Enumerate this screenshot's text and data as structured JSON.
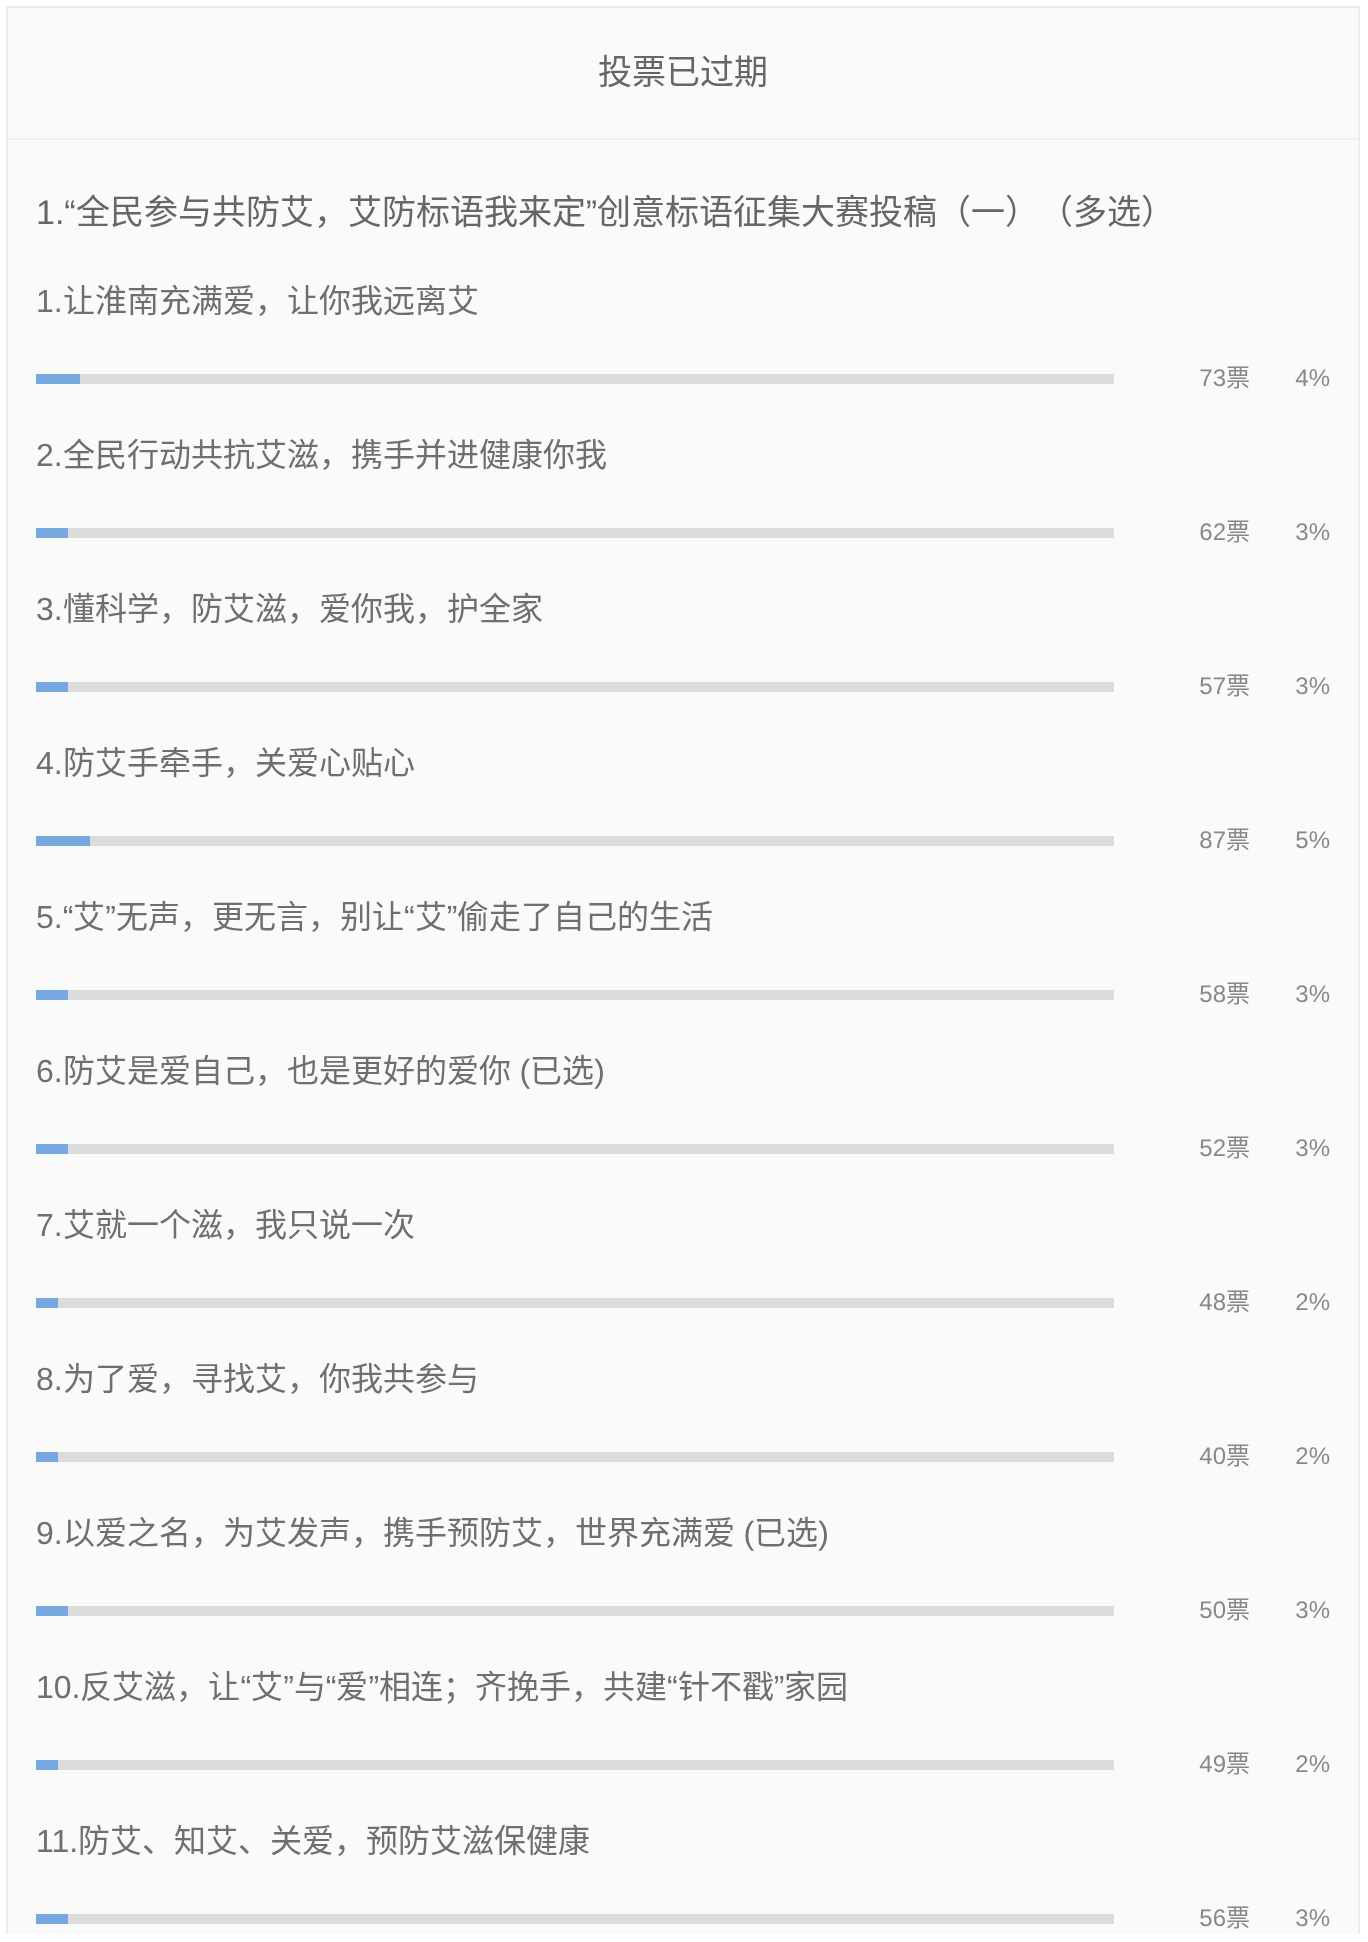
{
  "header": {
    "title": "投票已过期"
  },
  "question": {
    "title": "1.“全民参与共防艾，艾防标语我来定”创意标语征集大赛投稿（一）（多选）"
  },
  "options": [
    {
      "label": "1.让淮南充满爱，让你我远离艾",
      "votes": "73票",
      "percent": "4%",
      "level": 0.04
    },
    {
      "label": "2.全民行动共抗艾滋，携手并进健康你我",
      "votes": "62票",
      "percent": "3%",
      "level": 0.03
    },
    {
      "label": "3.懂科学，防艾滋，爱你我，护全家",
      "votes": "57票",
      "percent": "3%",
      "level": 0.03
    },
    {
      "label": "4.防艾手牵手，关爱心贴心",
      "votes": "87票",
      "percent": "5%",
      "level": 0.05
    },
    {
      "label": "5.“艾”无声，更无言，别让“艾”偷走了自己的生活",
      "votes": "58票",
      "percent": "3%",
      "level": 0.03
    },
    {
      "label": "6.防艾是爱自己，也是更好的爱你 (已选)",
      "votes": "52票",
      "percent": "3%",
      "level": 0.03
    },
    {
      "label": "7.艾就一个滋，我只说一次",
      "votes": "48票",
      "percent": "2%",
      "level": 0.02
    },
    {
      "label": "8.为了爱，寻找艾，你我共参与",
      "votes": "40票",
      "percent": "2%",
      "level": 0.02
    },
    {
      "label": "9.以爱之名，为艾发声，携手预防艾，世界充满爱 (已选)",
      "votes": "50票",
      "percent": "3%",
      "level": 0.03
    },
    {
      "label": "10.反艾滋，让“艾”与“爱”相连；齐挽手，共建“针不戳”家园",
      "votes": "49票",
      "percent": "2%",
      "level": 0.02
    },
    {
      "label": "11.防艾、知艾、关爱，预防艾滋保健康",
      "votes": "56票",
      "percent": "3%",
      "level": 0.03
    }
  ]
}
